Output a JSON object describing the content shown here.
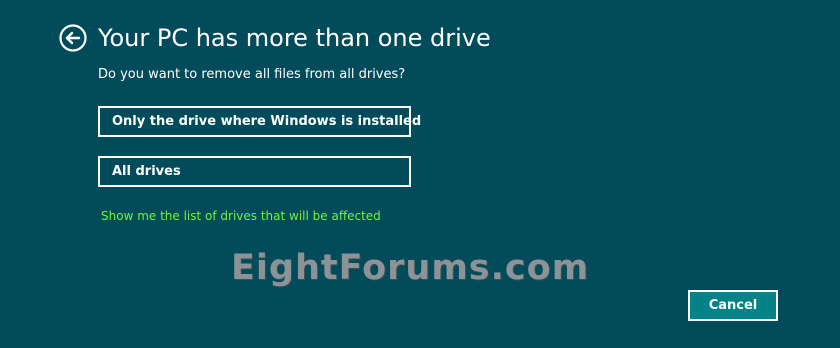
{
  "header": {
    "back_icon": "arrow-left-circle-icon",
    "title": "Your PC has more than one drive"
  },
  "question": "Do you want to remove all files from all drives?",
  "options": [
    {
      "label": "Only the drive where Windows is installed"
    },
    {
      "label": "All drives"
    }
  ],
  "link": {
    "label": "Show me the list of drives that will be affected"
  },
  "watermark": "EightForums.com",
  "footer": {
    "cancel_label": "Cancel"
  },
  "colors": {
    "background": "#024b5b",
    "link": "#6ff53e",
    "cancel_fill": "#038387",
    "watermark": "#8c9396"
  }
}
